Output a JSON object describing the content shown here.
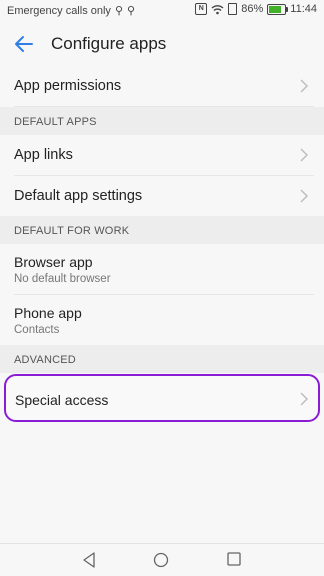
{
  "status": {
    "carrier": "Emergency calls only",
    "battery": "86%",
    "time": "11:44",
    "battery_level": 0.86
  },
  "header": {
    "title": "Configure apps"
  },
  "items": {
    "app_permissions": "App permissions",
    "app_links": "App links",
    "default_app_settings": "Default app settings",
    "browser_app": {
      "label": "Browser app",
      "sub": "No default browser"
    },
    "phone_app": {
      "label": "Phone app",
      "sub": "Contacts"
    },
    "special_access": "Special access"
  },
  "sections": {
    "default_apps": "DEFAULT APPS",
    "default_for_work": "DEFAULT FOR WORK",
    "advanced": "ADVANCED"
  },
  "colors": {
    "accent": "#2f7fe6",
    "highlight": "#8a1cd6",
    "battery_fill": "#43b02a"
  },
  "icons": [
    "usb-icon",
    "nfc-icon",
    "wifi-icon",
    "battery-icon",
    "back-arrow-icon",
    "chevron-right-icon",
    "nav-back-icon",
    "nav-home-icon",
    "nav-recent-icon"
  ]
}
